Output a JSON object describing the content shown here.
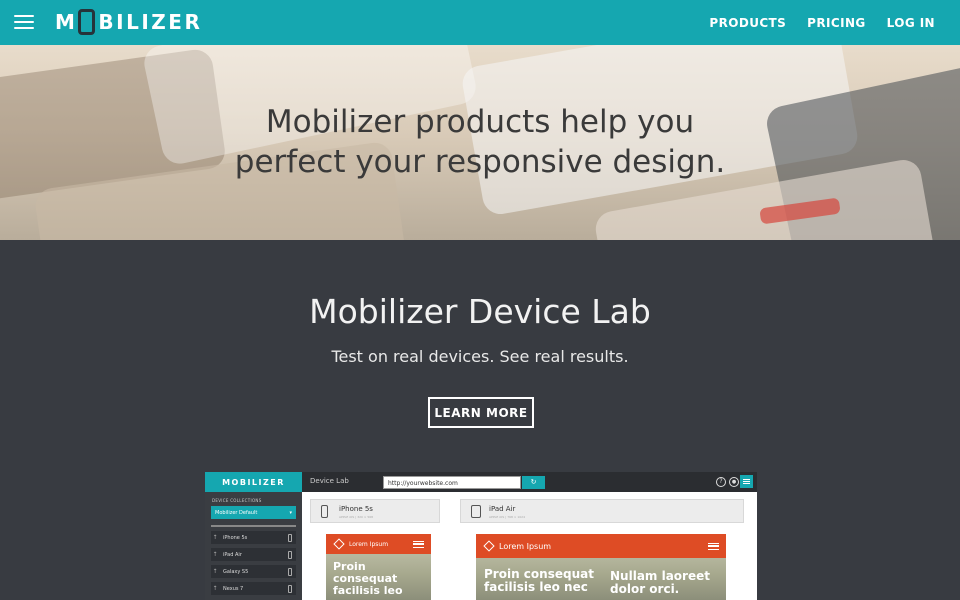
{
  "nav": {
    "logo_left": "M",
    "logo_right": "BILIZER",
    "links": [
      "PRODUCTS",
      "PRICING",
      "LOG IN"
    ]
  },
  "hero": {
    "line1": "Mobilizer products help you",
    "line2": "perfect your responsive design."
  },
  "lab": {
    "title": "Mobilizer Device Lab",
    "subtitle": "Test on real devices. See real results.",
    "button": "LEARN MORE"
  },
  "mockup": {
    "logo": "MOBILIZER",
    "collections_label": "DEVICE COLLECTIONS",
    "collection_selected": "Mobilizer Default",
    "devices": [
      "iPhone 5s",
      "iPad Air",
      "Galaxy S5",
      "Nexus 7"
    ],
    "toolbar_label": "Device Lab",
    "url_value": "http://yourwebsite.com",
    "reload_icon": "↻",
    "help_icon": "?",
    "user_icon": "●",
    "device_cards": [
      {
        "name": "iPhone 5s",
        "spec": "APPLE iOS | 320 × 568"
      },
      {
        "name": "iPad Air",
        "spec": "APPLE iOS | 768 × 1024"
      }
    ],
    "screens": [
      {
        "bar_title": "Lorem Ipsum",
        "text": "Proin consequat facilisis leo nec fermentum."
      },
      {
        "bar_title": "Lorem Ipsum",
        "text_left": "Proin consequat facilisis leo nec",
        "text_right": "Nullam laoreet dolor orci."
      }
    ]
  },
  "colors": {
    "brand_teal": "#15a7b0",
    "dark_bg": "#383b41",
    "accent_orange": "#de4c25"
  }
}
